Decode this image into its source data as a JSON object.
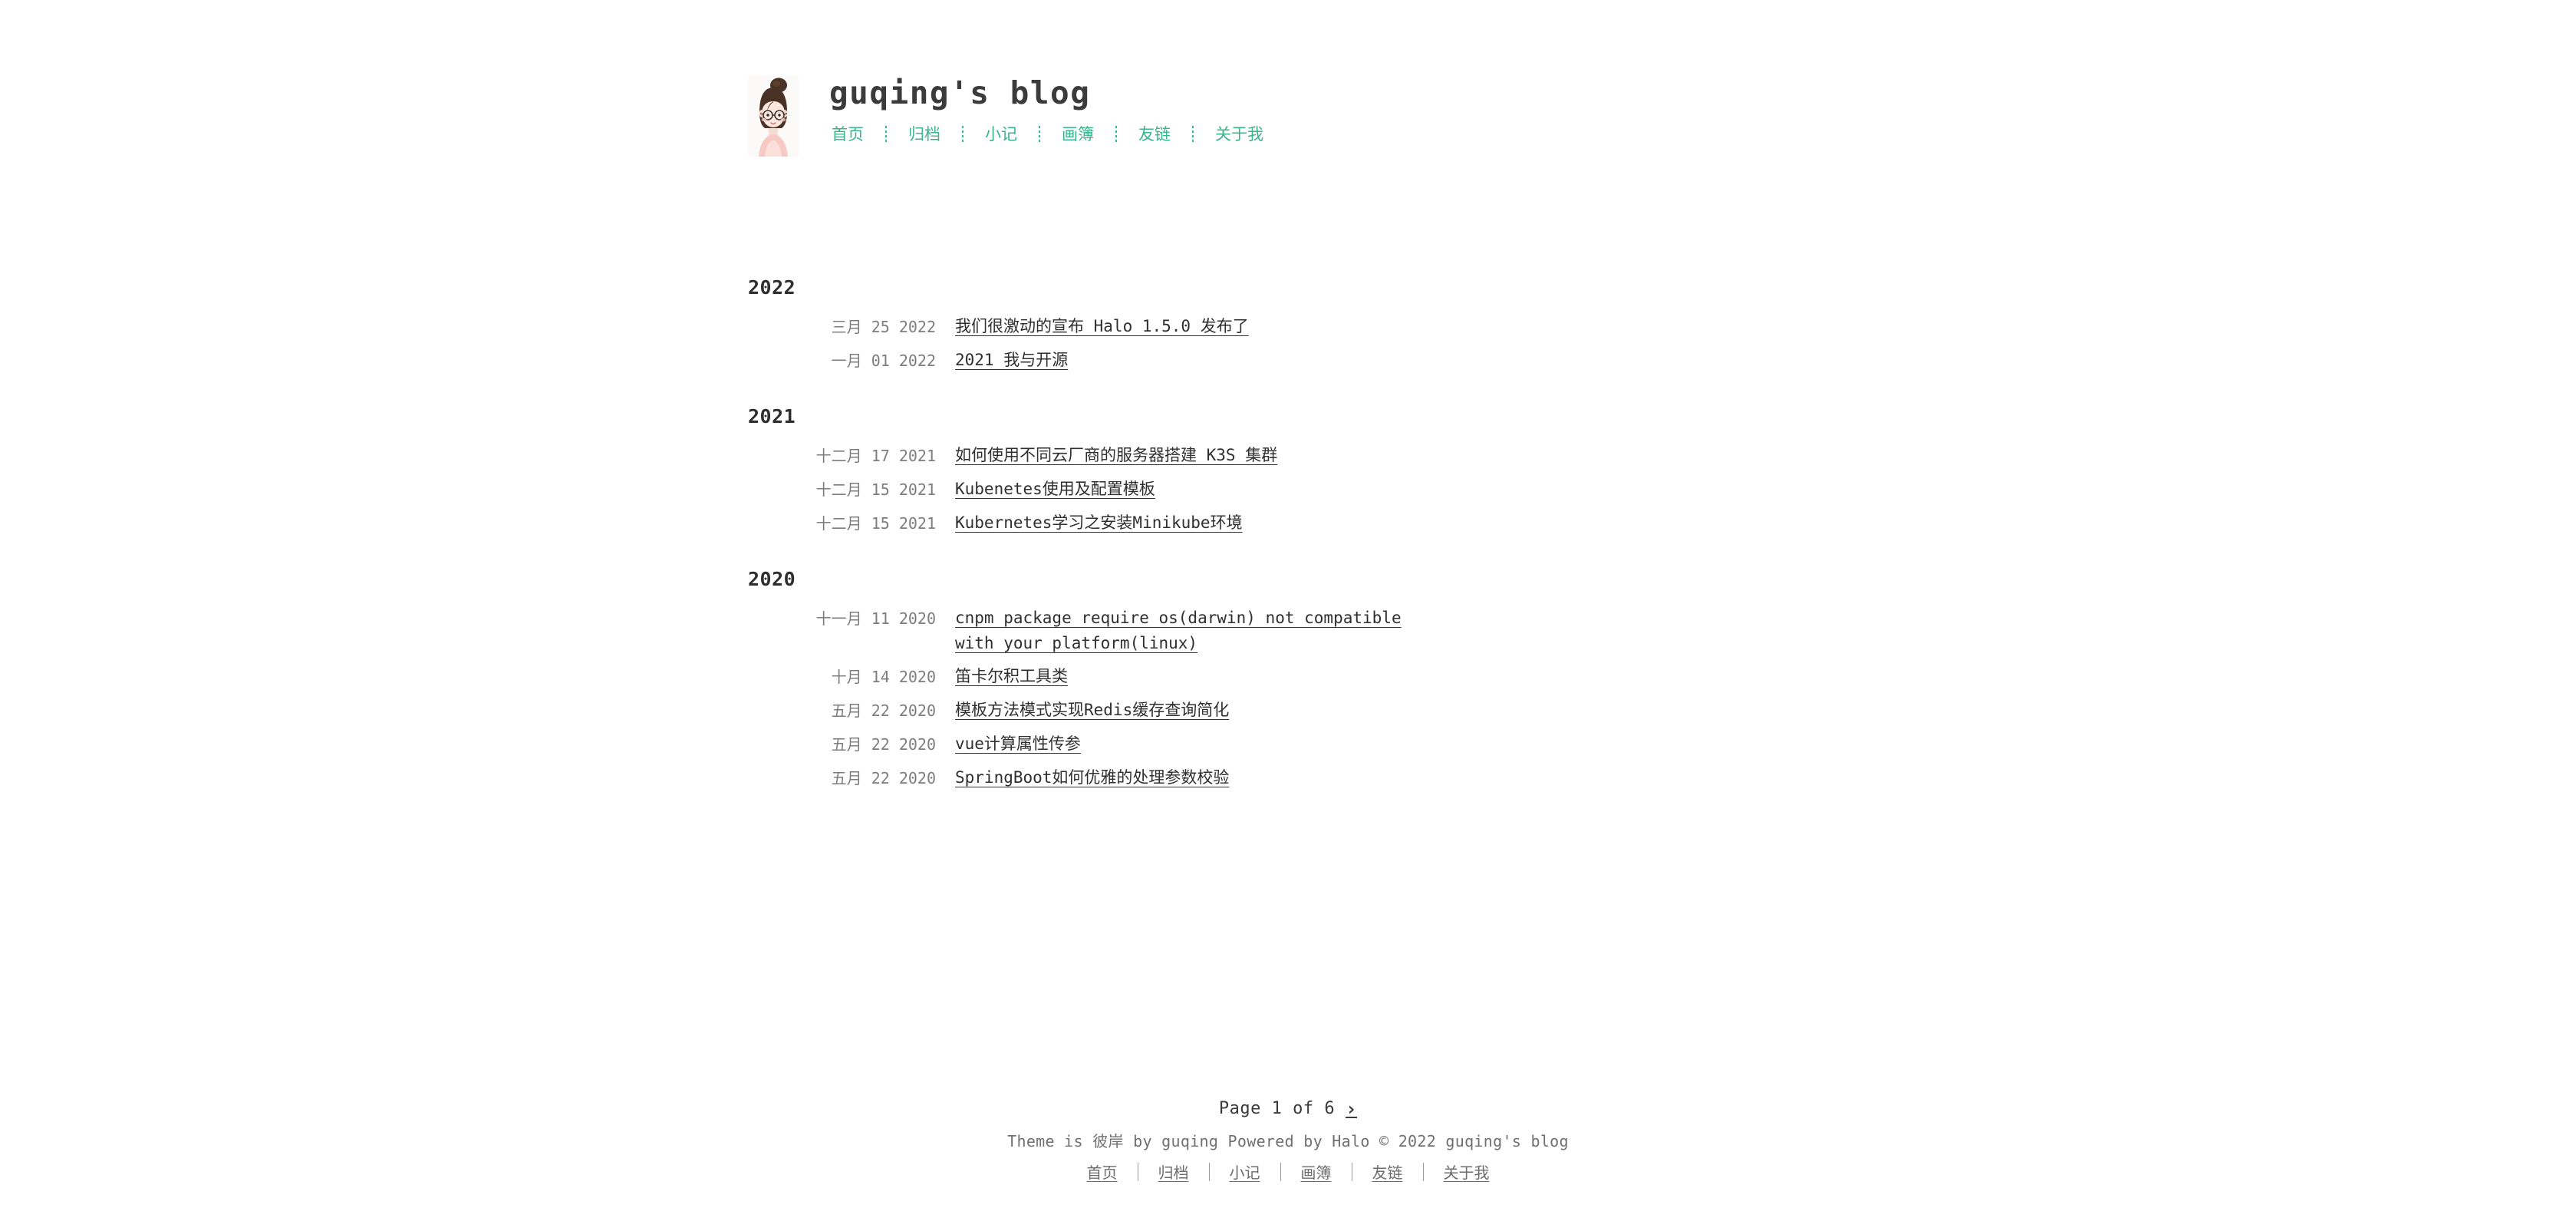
{
  "site": {
    "title": "guqing's blog",
    "avatar_icon": "avatar-illustration-woman-with-glasses"
  },
  "nav": {
    "items": [
      {
        "label": "首页"
      },
      {
        "label": "归档"
      },
      {
        "label": "小记"
      },
      {
        "label": "画簿"
      },
      {
        "label": "友链"
      },
      {
        "label": "关于我"
      }
    ]
  },
  "archive": {
    "years": [
      {
        "year": "2022",
        "posts": [
          {
            "date": "三月 25 2022",
            "title": "我们很激动的宣布 Halo 1.5.0 发布了"
          },
          {
            "date": "一月 01 2022",
            "title": "2021 我与开源"
          }
        ]
      },
      {
        "year": "2021",
        "posts": [
          {
            "date": "十二月 17 2021",
            "title": "如何使用不同云厂商的服务器搭建 K3S 集群"
          },
          {
            "date": "十二月 15 2021",
            "title": "Kubenetes使用及配置模板"
          },
          {
            "date": "十二月 15 2021",
            "title": "Kubernetes学习之安装Minikube环境"
          }
        ]
      },
      {
        "year": "2020",
        "posts": [
          {
            "date": "十一月 11 2020",
            "title": "cnpm package require os(darwin) not compatible with your platform(linux)"
          },
          {
            "date": "十月 14 2020",
            "title": "笛卡尔积工具类"
          },
          {
            "date": "五月 22 2020",
            "title": "模板方法模式实现Redis缓存查询简化"
          },
          {
            "date": "五月 22 2020",
            "title": "vue计算属性传参"
          },
          {
            "date": "五月 22 2020",
            "title": "SpringBoot如何优雅的处理参数校验"
          }
        ]
      }
    ]
  },
  "footer": {
    "pagination": {
      "label": "Page 1 of 6",
      "next_icon": "chevron-right-icon",
      "next_glyph": "›"
    },
    "credit": "Theme is 彼岸 by guqing Powered by Halo © 2022 guqing's blog",
    "links": [
      {
        "label": "首页"
      },
      {
        "label": "归档"
      },
      {
        "label": "小记"
      },
      {
        "label": "画簿"
      },
      {
        "label": "友链"
      },
      {
        "label": "关于我"
      }
    ]
  },
  "colors": {
    "accent_green": "#3cb489",
    "text_dark": "#2f2f2f",
    "text_muted": "#7d7d7d",
    "background": "#ffffff"
  }
}
